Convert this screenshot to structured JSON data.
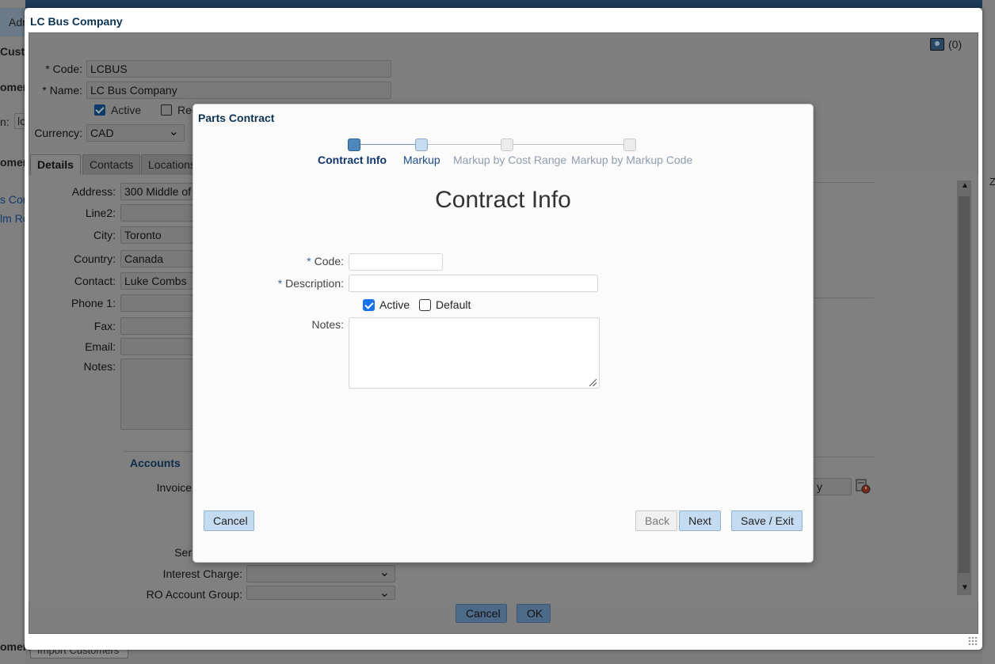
{
  "background_app": {
    "tab_fragment": "Adr",
    "label_custo": "Custo",
    "label_omers_1": "omers",
    "label_n": "n:",
    "label_lc": "lc",
    "label_omers_2": "omers",
    "link_1": "s Con",
    "link_2": "lm Re",
    "label_omers_bottom": "omers",
    "import_button": "Import Customers",
    "col_z": "Z"
  },
  "customer_dialog": {
    "title": "LC Bus Company",
    "notes_count": "(0)",
    "code_label": "* Code:",
    "code_value": "LCBUS",
    "name_label": "* Name:",
    "name_value": "LC Bus Company",
    "active_label": "Active",
    "active_checked": true,
    "rec_label": "Rec",
    "currency_label": "Currency:",
    "currency_value": "CAD",
    "tabs": [
      "Details",
      "Contacts",
      "Locations"
    ],
    "address_label": "Address:",
    "address_value": "300 Middle of",
    "line2_label": "Line2:",
    "city_label": "City:",
    "city_value": "Toronto",
    "country_label": "Country:",
    "country_value": "Canada",
    "contact_label": "Contact:",
    "contact_value": "Luke Combs",
    "phone_label": "Phone 1:",
    "fax_label": "Fax:",
    "email_label": "Email:",
    "notes_label": "Notes:",
    "accounts_heading": "Accounts",
    "invoice_label": "Invoice",
    "ser_label": "Ser",
    "interest_label": "Interest Charge:",
    "ro_group_label": "RO Account Group:",
    "right_field_fragment": "y",
    "cancel_button": "Cancel",
    "ok_button": "OK"
  },
  "wizard": {
    "title": "Parts Contract",
    "steps": [
      {
        "label": "Contract Info",
        "state": "current"
      },
      {
        "label": "Markup",
        "state": "next"
      },
      {
        "label": "Markup by Cost Range",
        "state": "pending"
      },
      {
        "label": "Markup by Markup Code",
        "state": "pending"
      }
    ],
    "heading": "Contract Info",
    "code_label": "Code:",
    "code_value": "",
    "description_label": "Description:",
    "description_value": "",
    "required_marker": "*",
    "active_label": "Active",
    "active_checked": true,
    "default_label": "Default",
    "default_checked": false,
    "notes_label": "Notes:",
    "notes_value": "",
    "cancel_button": "Cancel",
    "back_button": "Back",
    "next_button": "Next",
    "save_exit_button": "Save / Exit"
  }
}
